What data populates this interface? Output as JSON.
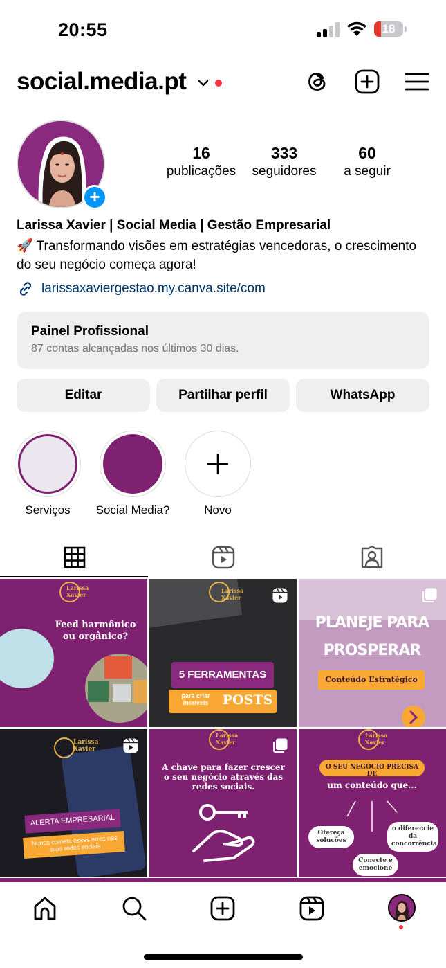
{
  "status_bar": {
    "time": "20:55",
    "battery": "18"
  },
  "header": {
    "username": "social.media.pt"
  },
  "profile": {
    "stats": [
      {
        "value": "16",
        "label": "publicações"
      },
      {
        "value": "333",
        "label": "seguidores"
      },
      {
        "value": "60",
        "label": "a seguir"
      }
    ],
    "name": "Larissa Xavier | Social Media | Gestão Empresarial",
    "bio": "🚀 Transformando visões em estratégias vencedoras, o crescimento do seu negócio começa agora!",
    "link": "larissaxaviergestao.my.canva.site/com"
  },
  "dashboard": {
    "title": "Painel Profissional",
    "subtitle": "87 contas alcançadas nos últimos 30 dias."
  },
  "buttons": {
    "edit": "Editar",
    "share": "Partilhar perfil",
    "whatsapp": "WhatsApp"
  },
  "highlights": [
    {
      "label": "Serviços"
    },
    {
      "label": "Social Media?"
    },
    {
      "label": "Novo"
    }
  ],
  "posts": {
    "p1": {
      "logo": "Larissa Xavier",
      "text": "Feed harmônico ou orgânico?"
    },
    "p2": {
      "logo": "Larissa Xavier",
      "line1": "5 FERRAMENTAS",
      "line2": "para criar incríveis",
      "line3": "POSTS"
    },
    "p3": {
      "title": "PLANEJE PARA PROSPERAR",
      "tag": "Conteúdo Estratégico"
    },
    "p4": {
      "logo": "Larissa Xavier",
      "line1": "ALERTA EMPRESARIAL",
      "line2": "Nunca cometa esses erros nas suas redes sociais"
    },
    "p5": {
      "logo": "Larissa Xavier",
      "text": "A chave para fazer crescer o seu negócio através das redes sociais."
    },
    "p6": {
      "logo": "Larissa Xavier",
      "tag": "O SEU NEGÓCIO PRECISA DE",
      "sub": "um conteúdo que...",
      "b1": "Ofereça soluções",
      "b2": "o diferencie da concorrência",
      "b3": "Conecte e emocione"
    }
  },
  "colors": {
    "brand_purple": "#7e2170",
    "accent_orange": "#f9a833",
    "link_blue": "#00376b",
    "add_blue": "#0095f6",
    "notif_red": "#ff3040"
  }
}
